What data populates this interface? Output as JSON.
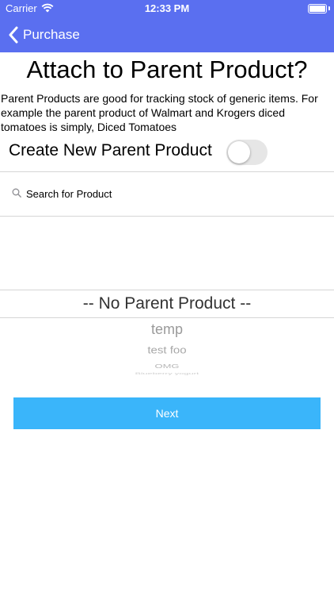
{
  "status_bar": {
    "carrier": "Carrier",
    "time": "12:33 PM"
  },
  "nav": {
    "back_label": "Purchase",
    "back_icon": "chevron-left-icon"
  },
  "page": {
    "title": "Attach to Parent Product?",
    "description": "Parent Products are good for tracking stock of generic items. For example the parent product of Walmart and Krogers diced tomatoes is simply, Diced Tomatoes"
  },
  "toggle": {
    "label": "Create New Parent Product",
    "on": false
  },
  "search": {
    "placeholder": "Search for Product",
    "value": ""
  },
  "picker": {
    "selected": "-- No Parent Product --",
    "options": [
      "temp",
      "test foo",
      "OMG",
      "Blueberry yogurt"
    ]
  },
  "next_label": "Next",
  "colors": {
    "nav_background": "#5a6ff0",
    "button_background": "#3ab5fa"
  }
}
